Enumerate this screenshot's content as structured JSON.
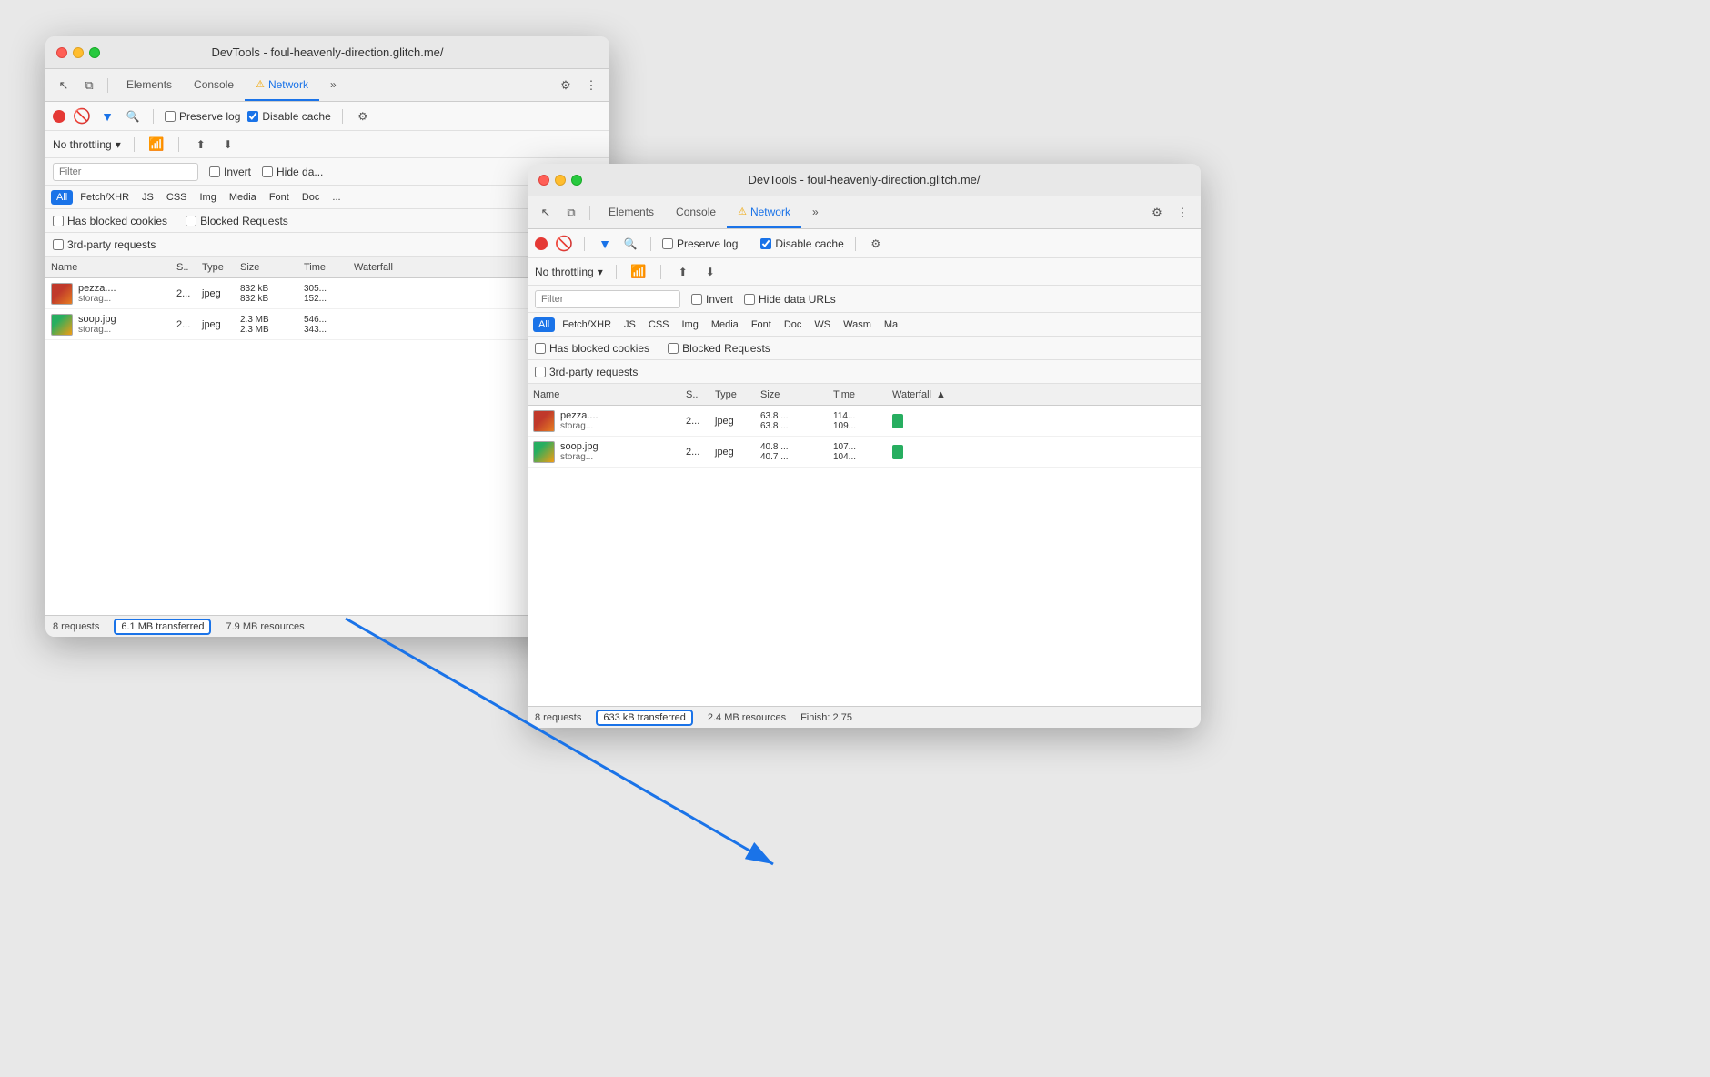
{
  "window1": {
    "title": "DevTools - foul-heavenly-direction.glitch.me/",
    "tabs": [
      "Elements",
      "Console",
      "Network"
    ],
    "activeTab": "Network",
    "toolbar": {
      "preserveLog": false,
      "disableCache": true
    },
    "throttling": "No throttling",
    "filterPlaceholder": "Filter",
    "filterTypes": [
      "All",
      "Fetch/XHR",
      "JS",
      "CSS",
      "Img",
      "Media",
      "Font",
      "Doc"
    ],
    "activeFilter": "All",
    "checkboxes": {
      "hasBlockedCookies": "Has blocked cookies",
      "blockedRequests": "Blocked Requests",
      "thirdParty": "3rd-party requests"
    },
    "tableHeaders": [
      "Name",
      "S..",
      "Type",
      "Size",
      "Time",
      "Waterfall"
    ],
    "rows": [
      {
        "thumb": "pizza",
        "name": "pezza....",
        "sub": "storag...",
        "s": "2...",
        "type": "jpeg",
        "size1": "832 kB",
        "size2": "832 kB",
        "time1": "305...",
        "time2": "152..."
      },
      {
        "thumb": "soop",
        "name": "soop.jpg",
        "sub": "storag...",
        "s": "2...",
        "type": "jpeg",
        "size1": "2.3 MB",
        "size2": "2.3 MB",
        "time1": "546...",
        "time2": "343..."
      }
    ],
    "statusBar": {
      "requests": "8 requests",
      "transferred": "6.1 MB transferred",
      "resources": "7.9 MB resources"
    }
  },
  "window2": {
    "title": "DevTools - foul-heavenly-direction.glitch.me/",
    "tabs": [
      "Elements",
      "Console",
      "Network"
    ],
    "activeTab": "Network",
    "toolbar": {
      "preserveLog": false,
      "disableCache": true
    },
    "throttling": "No throttling",
    "filterPlaceholder": "Filter",
    "filterTypes": [
      "All",
      "Fetch/XHR",
      "JS",
      "CSS",
      "Img",
      "Media",
      "Font",
      "Doc",
      "WS",
      "Wasm",
      "Ma"
    ],
    "activeFilter": "All",
    "checkboxes": {
      "hasBlockedCookies": "Has blocked cookies",
      "blockedRequests": "Blocked Requests",
      "thirdParty": "3rd-party requests"
    },
    "filterExtras": {
      "invert": "Invert",
      "hideDataURLs": "Hide data URLs"
    },
    "tableHeaders": [
      "Name",
      "S..",
      "Type",
      "Size",
      "Time",
      "Waterfall"
    ],
    "rows": [
      {
        "thumb": "pizza",
        "name": "pezza....",
        "sub": "storag...",
        "s": "2...",
        "type": "jpeg",
        "size1": "63.8 ...",
        "size2": "63.8 ...",
        "time1": "114...",
        "time2": "109..."
      },
      {
        "thumb": "soop",
        "name": "soop.jpg",
        "sub": "storag...",
        "s": "2...",
        "type": "jpeg",
        "size1": "40.8 ...",
        "size2": "40.7 ...",
        "time1": "107...",
        "time2": "104..."
      }
    ],
    "statusBar": {
      "requests": "8 requests",
      "transferred": "633 kB transferred",
      "resources": "2.4 MB resources",
      "finish": "Finish: 2.75"
    }
  },
  "colors": {
    "accent": "#1a73e8",
    "arrowColor": "#1a73e8"
  }
}
